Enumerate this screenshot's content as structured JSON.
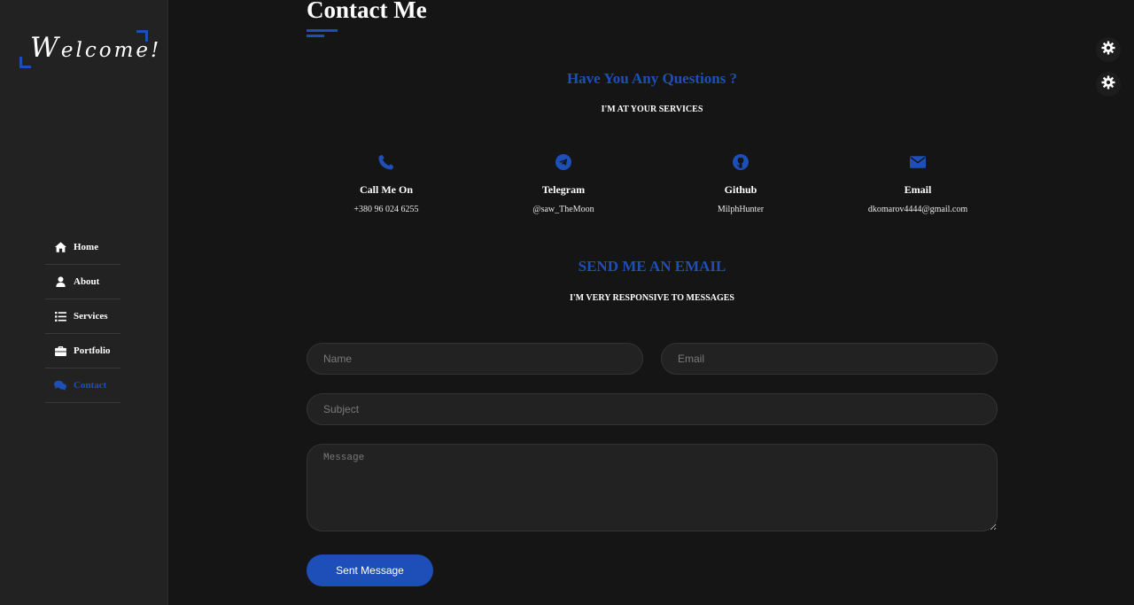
{
  "colors": {
    "accent": "#1e4fb8",
    "background": "#151515",
    "sidebar": "#222222"
  },
  "sidebar": {
    "logo_first": "W",
    "logo_rest": "elcome!",
    "items": [
      {
        "label": "Home",
        "icon": "home-icon",
        "active": false
      },
      {
        "label": "About",
        "icon": "user-icon",
        "active": false
      },
      {
        "label": "Services",
        "icon": "list-icon",
        "active": false
      },
      {
        "label": "Portfolio",
        "icon": "briefcase-icon",
        "active": false
      },
      {
        "label": "Contact",
        "icon": "comments-icon",
        "active": true
      }
    ]
  },
  "page": {
    "title": "Contact Me",
    "questions_heading": "Have You Any Questions ?",
    "questions_sub": "I'M AT YOUR SERVICES",
    "contacts": [
      {
        "title": "Call Me On",
        "value": "+380 96 024 6255",
        "icon": "phone-icon"
      },
      {
        "title": "Telegram",
        "value": "@saw_TheMoon",
        "icon": "telegram-icon"
      },
      {
        "title": "Github",
        "value": "MilphHunter",
        "icon": "github-icon"
      },
      {
        "title": "Email",
        "value": "dkomarov4444@gmail.com",
        "icon": "envelope-icon"
      }
    ],
    "email_heading": "SEND ME AN EMAIL",
    "email_sub": "I'M VERY RESPONSIVE TO MESSAGES"
  },
  "form": {
    "name_placeholder": "Name",
    "email_placeholder": "Email",
    "subject_placeholder": "Subject",
    "message_placeholder": "Message",
    "submit_label": "Sent Message"
  },
  "settings": [
    {
      "icon": "gear-icon"
    },
    {
      "icon": "gear-icon"
    }
  ]
}
